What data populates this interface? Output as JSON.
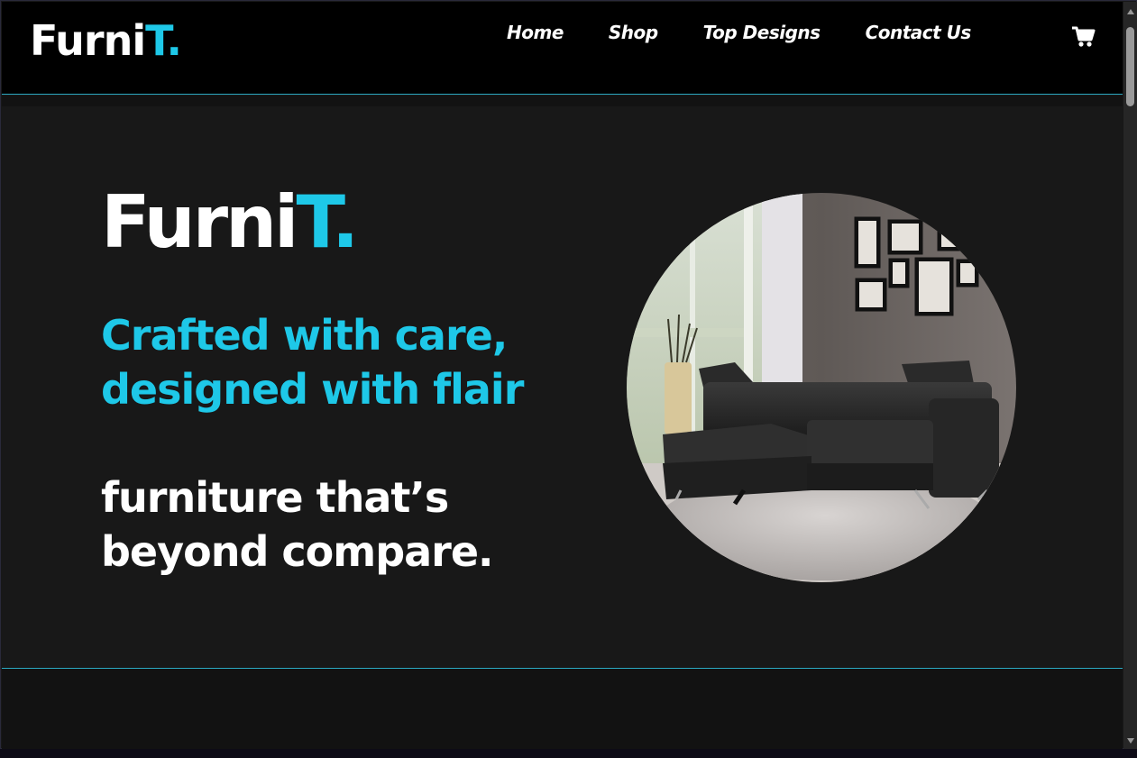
{
  "header": {
    "logo_main": "Furni",
    "logo_accent": "T."
  },
  "nav": {
    "items": [
      "Home",
      "Shop",
      "Top Designs",
      "Contact Us"
    ]
  },
  "icons": {
    "cart": "shopping-cart-icon"
  },
  "hero": {
    "title_main": "Furni",
    "title_accent": "T.",
    "tagline_line1": "Crafted with care,",
    "tagline_line2": "designed with flair",
    "subline_line1": "furniture that’s",
    "subline_line2": "beyond compare."
  },
  "colors": {
    "accent": "#1ec8e8",
    "background": "#181818",
    "header": "#000000",
    "text": "#ffffff"
  }
}
